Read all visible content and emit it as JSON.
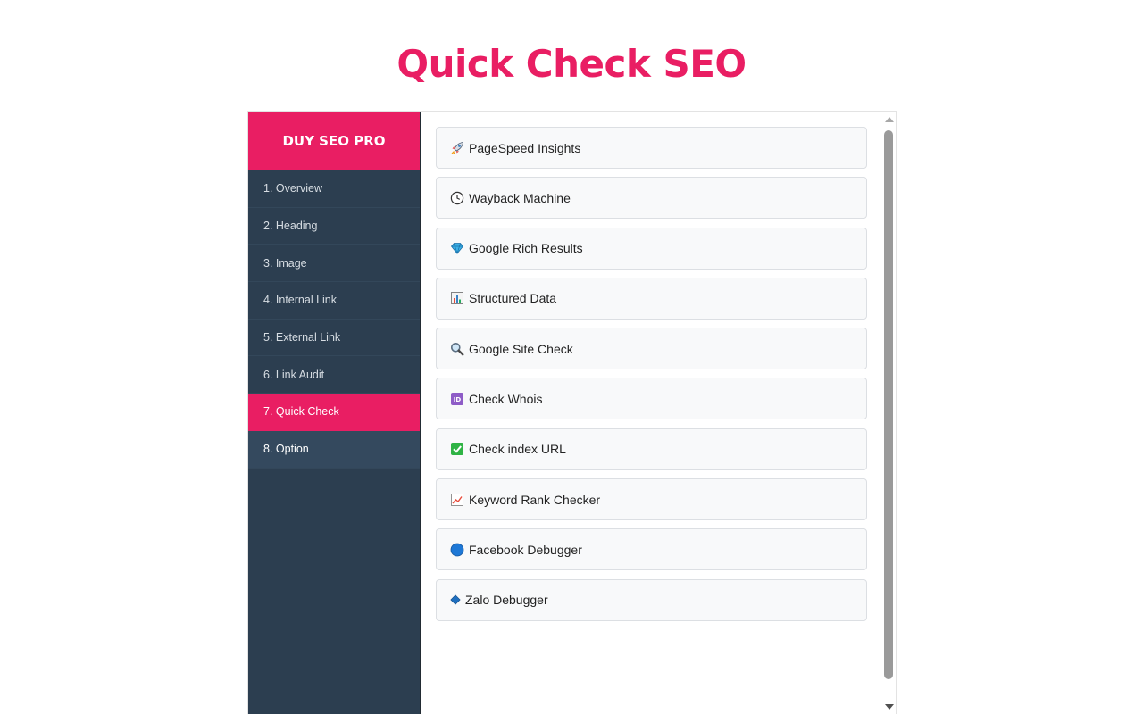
{
  "page": {
    "title": "Quick Check SEO"
  },
  "sidebar": {
    "brand": "DUY SEO PRO",
    "items": [
      {
        "label": "1. Overview"
      },
      {
        "label": "2. Heading"
      },
      {
        "label": "3. Image"
      },
      {
        "label": "4. Internal Link"
      },
      {
        "label": "5. External Link"
      },
      {
        "label": "6. Link Audit"
      },
      {
        "label": "7. Quick Check",
        "active": true
      },
      {
        "label": "8. Option"
      }
    ]
  },
  "tools": [
    {
      "label": "PageSpeed Insights",
      "icon": "rocket-icon"
    },
    {
      "label": "Wayback Machine",
      "icon": "clock-icon"
    },
    {
      "label": "Google Rich Results",
      "icon": "gem-icon"
    },
    {
      "label": "Structured Data",
      "icon": "bar-chart-icon"
    },
    {
      "label": "Google Site Check",
      "icon": "magnifier-icon"
    },
    {
      "label": "Check Whois",
      "icon": "id-icon"
    },
    {
      "label": "Check index URL",
      "icon": "check-mark-icon"
    },
    {
      "label": "Keyword Rank Checker",
      "icon": "chart-increasing-icon"
    },
    {
      "label": "Facebook Debugger",
      "icon": "blue-circle-icon"
    },
    {
      "label": "Zalo Debugger",
      "icon": "blue-diamond-icon"
    }
  ],
  "colors": {
    "accent": "#e91e63",
    "sidebar_bg": "#2c3e50",
    "button_bg": "#f8f9fa"
  }
}
